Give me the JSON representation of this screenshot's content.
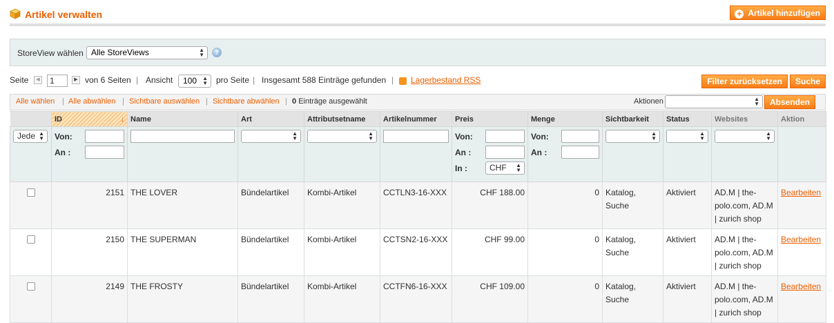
{
  "header": {
    "title": "Artikel verwalten",
    "add_button": "Artikel hinzufügen"
  },
  "switcher": {
    "label": "StoreView wählen",
    "selected": "Alle StoreViews"
  },
  "pager": {
    "page_label": "Seite",
    "page_value": "1",
    "of_pages": "von 6 Seiten",
    "view_label": "Ansicht",
    "per_page": "100",
    "per_page_suffix": "pro Seite",
    "total": "Insgesamt 588 Einträge gefunden",
    "rss": "Lagerbestand RSS",
    "reset": "Filter zurücksetzen",
    "search": "Suche"
  },
  "massaction": {
    "select_all": "Alle wählen",
    "unselect_all": "Alle abwählen",
    "select_visible": "Sichtbare auswählen",
    "unselect_visible": "Sichtbare abwählen",
    "count": "0",
    "count_suffix": "Einträge ausgewählt",
    "actions_label": "Aktionen",
    "submit": "Absenden"
  },
  "columns": [
    "ID",
    "Name",
    "Art",
    "Attributsetname",
    "Artikelnummer",
    "Preis",
    "Menge",
    "Sichtbarkeit",
    "Status",
    "Websites",
    "Aktion"
  ],
  "filters": {
    "any_option": "Jede",
    "from": "Von:",
    "to": "An :",
    "in": "In :",
    "currency": "CHF"
  },
  "rows": [
    {
      "id": "2151",
      "name": "THE LOVER",
      "type": "Bündelartikel",
      "attr_set": "Kombi-Artikel",
      "sku": "CCTLN3-16-XXX",
      "price": "CHF 188.00",
      "qty": "0",
      "visibility": "Katalog, Suche",
      "status": "Aktiviert",
      "websites": "AD.M | the-polo.com, AD.M | zurich shop",
      "action": "Bearbeiten"
    },
    {
      "id": "2150",
      "name": "THE SUPERMAN",
      "type": "Bündelartikel",
      "attr_set": "Kombi-Artikel",
      "sku": "CCTSN2-16-XXX",
      "price": "CHF 99.00",
      "qty": "0",
      "visibility": "Katalog, Suche",
      "status": "Aktiviert",
      "websites": "AD.M | the-polo.com, AD.M | zurich shop",
      "action": "Bearbeiten"
    },
    {
      "id": "2149",
      "name": "THE FROSTY",
      "type": "Bündelartikel",
      "attr_set": "Kombi-Artikel",
      "sku": "CCTFN6-16-XXX",
      "price": "CHF 109.00",
      "qty": "0",
      "visibility": "Katalog, Suche",
      "status": "Aktiviert",
      "websites": "AD.M | the-polo.com, AD.M | zurich shop",
      "action": "Bearbeiten"
    }
  ]
}
